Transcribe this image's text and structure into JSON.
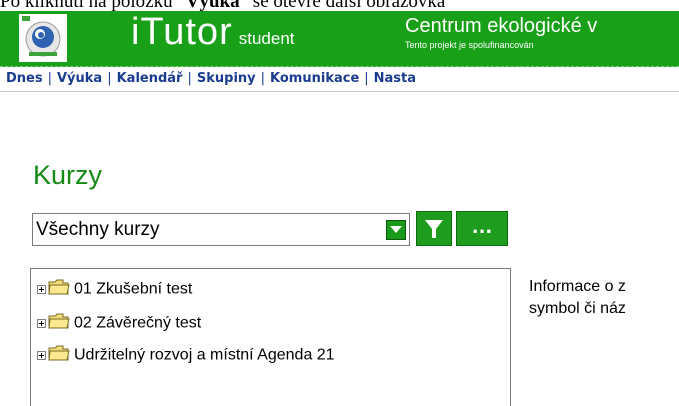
{
  "document_caption": {
    "prefix": "Po kliknutí na položku “",
    "bold": "Výuka",
    "suffix": "” se otevře další obrazovka"
  },
  "header": {
    "brand_big": "iTutor",
    "brand_small": "student",
    "centrum_title": "Centrum ekologické v",
    "centrum_subtitle": "Tento projekt je spolufinancován"
  },
  "menu": [
    {
      "label": "Dnes"
    },
    {
      "label": "Výuka"
    },
    {
      "label": "Kalendář"
    },
    {
      "label": "Skupiny"
    },
    {
      "label": "Komunikace"
    },
    {
      "label": "Nasta"
    }
  ],
  "page": {
    "title": "Kurzy",
    "course_select_value": "Všechny kurzy",
    "more_button_label": "..."
  },
  "tree": [
    {
      "label": "01 Zkušební test"
    },
    {
      "label": "02 Závěrečný test"
    },
    {
      "label": "Udržitelný rozvoj a místní Agenda 21"
    }
  ],
  "info": {
    "line1": "Informace o z",
    "line2": "symbol či náz"
  },
  "colors": {
    "header_green": "#18a018",
    "title_green": "#148a14",
    "menu_blue": "#1a3c8f"
  }
}
